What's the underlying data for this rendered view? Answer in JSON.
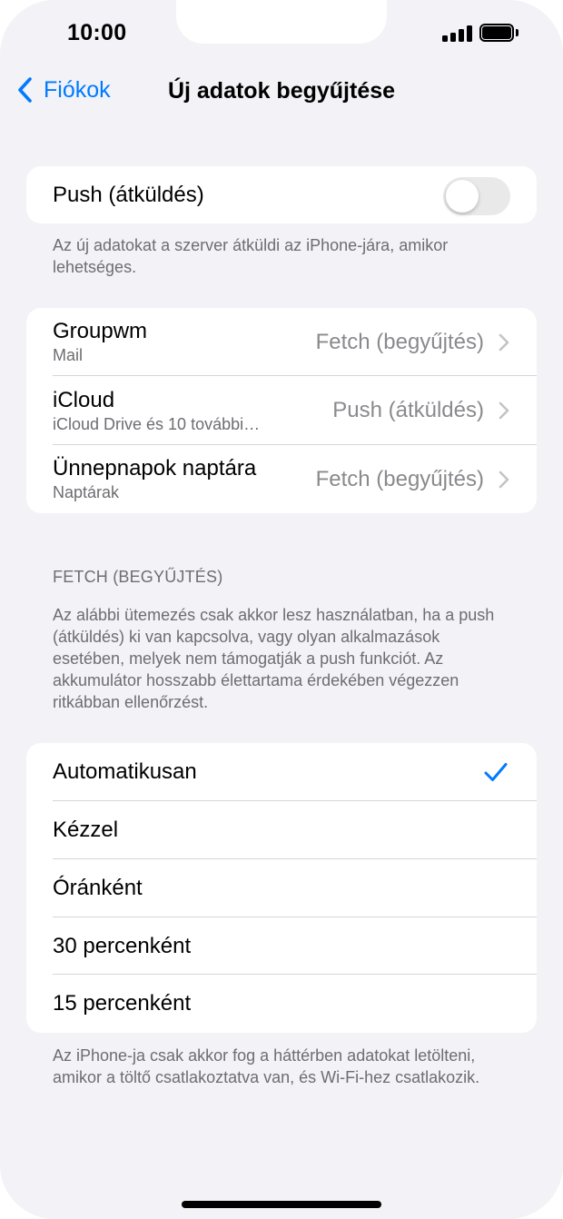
{
  "status_bar": {
    "time": "10:00"
  },
  "nav": {
    "back_label": "Fiókok",
    "title": "Új adatok begyűjtése"
  },
  "push_group": {
    "label": "Push (átküldés)",
    "enabled": false,
    "footer": "Az új adatokat a szerver átküldi az iPhone-jára, amikor lehetséges."
  },
  "accounts": [
    {
      "name": "Groupwm",
      "sub": "Mail",
      "value": "Fetch (begyűjtés)"
    },
    {
      "name": "iCloud",
      "sub": "iCloud Drive és 10 további…",
      "value": "Push (átküldés)"
    },
    {
      "name": "Ünnepnapok naptára",
      "sub": "Naptárak",
      "value": "Fetch (begyűjtés)"
    }
  ],
  "fetch_section": {
    "header": "FETCH (BEGYŰJTÉS)",
    "description": "Az alábbi ütemezés csak akkor lesz használatban, ha a push (átküldés) ki van kapcsolva, vagy olyan alkalmazások esetében, melyek nem támogatják a push funkciót. Az akkumulátor hosszabb élettartama érdekében végezzen ritkábban ellenőrzést.",
    "options": [
      {
        "label": "Automatikusan",
        "selected": true
      },
      {
        "label": "Kézzel",
        "selected": false
      },
      {
        "label": "Óránként",
        "selected": false
      },
      {
        "label": "30 percenként",
        "selected": false
      },
      {
        "label": "15 percenként",
        "selected": false
      }
    ],
    "footer": "Az iPhone-ja csak akkor fog a háttérben adatokat letölteni, amikor a töltő csatlakoztatva van, és Wi-Fi-hez csatlakozik."
  },
  "colors": {
    "accent": "#007aff",
    "background": "#f2f2f7",
    "secondary_text": "#6d6d72"
  }
}
